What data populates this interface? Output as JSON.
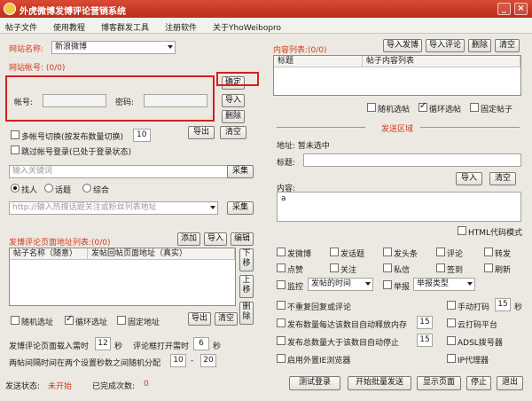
{
  "window": {
    "title": "外虎微博发博评论营销系统",
    "min": "_",
    "close": "×"
  },
  "menu": [
    "帖子文件",
    "使用教程",
    "博客群发工具",
    "注册软件",
    "关于YhoWeibopro"
  ],
  "left": {
    "site_label": "网站名称:",
    "site_value": "新浪微博",
    "account_header": "网站帐号: (0/0)",
    "account_label": "帐号:",
    "password_label": "密码:",
    "confirm": "确定",
    "import": "导入",
    "delete": "删除",
    "export": "导出",
    "clear": "清空",
    "multi_switch": "多帐号切换(按发布数量切换)",
    "multi_count": "10",
    "skip_login": "跳过帐号登录(已处于登录状态)",
    "keyword_placeholder": "输入关键词",
    "collect1": "采集",
    "radio": [
      "找人",
      "话题",
      "综合"
    ],
    "url_placeholder": "http://输入热搜话题关注或粉丝列表地址",
    "collect2": "采集",
    "list_header": "发博评论页面地址列表:(0/0)",
    "add": "添加",
    "import2": "导入",
    "edit": "编辑",
    "col1": "帖子名称（随意）",
    "col2": "发帖回帖页面地址（真实）",
    "move_up": "上移",
    "move_down": "下移",
    "delete2": "删除",
    "random_url": "随机选址",
    "loop_url": "循环选址",
    "fixed_url": "固定地址",
    "export2": "导出",
    "clear2": "清空",
    "load_wait_label": "发博评论页面载入需时",
    "load_wait": "12",
    "load_wait_unit": "秒",
    "comment_wait_label": "评论框打开需时",
    "comment_wait": "6",
    "comment_wait_unit": "秒",
    "interval_label": "两帖间隔时间在两个设置秒数之间随机分配",
    "interval_from": "10",
    "interval_sep": "-",
    "interval_to": "20",
    "status_label": "发送状态:",
    "status_value": "未开始",
    "done_label": "已完成次数:",
    "done_value": "0"
  },
  "right": {
    "content_header": "内容列表:(0/0)",
    "import_post": "导入发博",
    "import_comment": "导入评论",
    "delete": "删除",
    "clear": "清空",
    "col1": "标题",
    "col2": "帖子内容列表",
    "random_post": "随机选帖",
    "loop_post": "循环选帖",
    "fixed_post": "固定帖子",
    "send_area": "发送区域",
    "selected": "地址: 暂未选中",
    "title_label": "标题:",
    "import": "导入",
    "clear2": "清空",
    "content_label": "内容:",
    "content_value": "a",
    "html_mode": "HTML代码模式",
    "options": [
      [
        "发微博",
        "发话题",
        "发头条",
        "评论",
        "转发"
      ],
      [
        "点赞",
        "关注",
        "私信",
        "签到",
        "刷新"
      ]
    ],
    "monitor": "监控",
    "monitor_select": "发帖的时间",
    "report": "举报",
    "report_select": "举报类型",
    "no_repeat": "不重复回复或评论",
    "manual_captcha": "手动打码",
    "manual_captcha_val": "15",
    "manual_captcha_unit": "秒",
    "auto_release": "发布数量每达该数目自动释放内存",
    "auto_release_val": "15",
    "cloud_captcha": "云打码平台",
    "auto_stop": "发布总数量大于该数目自动停止",
    "auto_stop_val": "15",
    "adsl": "ADSL拨号器",
    "ie_browser": "启用外置IE浏览器",
    "ip_proxy": "IP代理器"
  },
  "bottom": [
    "测试登录",
    "开始批量发送",
    "显示页面",
    "停止",
    "退出"
  ]
}
